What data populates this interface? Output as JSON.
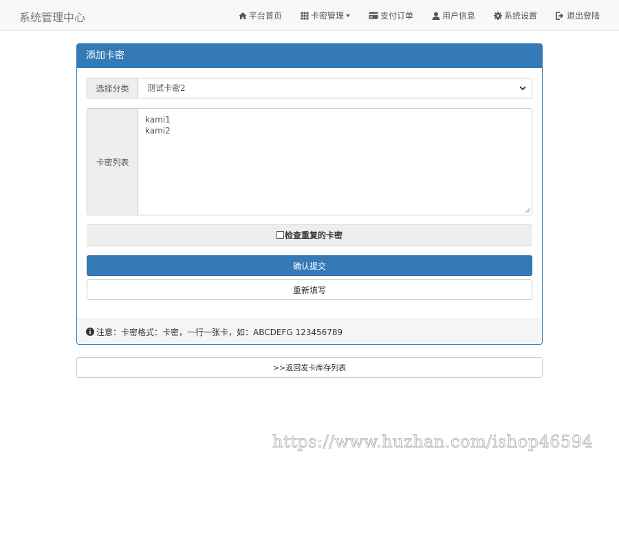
{
  "navbar": {
    "brand": "系统管理中心",
    "items": [
      {
        "label": "平台首页",
        "icon": "home-icon"
      },
      {
        "label": "卡密管理",
        "icon": "grid-icon",
        "dropdown": true
      },
      {
        "label": "支付订单",
        "icon": "credit-card-icon"
      },
      {
        "label": "用户信息",
        "icon": "user-icon"
      },
      {
        "label": "系统设置",
        "icon": "gear-icon"
      },
      {
        "label": "退出登陆",
        "icon": "logout-icon"
      }
    ]
  },
  "panel": {
    "title": "添加卡密",
    "category": {
      "label": "选择分类",
      "selected": "测试卡密2"
    },
    "cards": {
      "label": "卡密列表",
      "lines": [
        "kami1",
        "kami2"
      ]
    },
    "check_duplicates": {
      "label": "检查重复的卡密",
      "checked": false
    },
    "submit_label": "确认提交",
    "reset_label": "重新填写",
    "note": "注意：卡密格式：卡密，一行一张卡，如：ABCDEFG 123456789"
  },
  "back_link": ">>返回发卡库存列表",
  "watermark": "https://www.huzhan.com/ishop46594",
  "colors": {
    "primary": "#337ab7",
    "navbar_bg": "#f8f8f8",
    "addon_bg": "#eeeeee"
  }
}
